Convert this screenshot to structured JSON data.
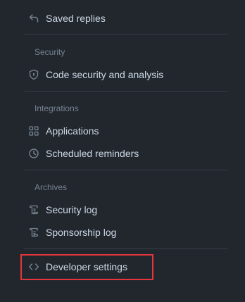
{
  "menu": {
    "partial_item_icon": "log-icon",
    "saved_replies": {
      "label": "Saved replies",
      "icon": "reply-icon"
    },
    "sections": [
      {
        "title": "Security",
        "items": [
          {
            "label": "Code security and analysis",
            "icon": "shield-lock-icon"
          }
        ]
      },
      {
        "title": "Integrations",
        "items": [
          {
            "label": "Applications",
            "icon": "apps-grid-icon"
          },
          {
            "label": "Scheduled reminders",
            "icon": "clock-icon"
          }
        ]
      },
      {
        "title": "Archives",
        "items": [
          {
            "label": "Security log",
            "icon": "log-icon"
          },
          {
            "label": "Sponsorship log",
            "icon": "log-icon"
          }
        ]
      }
    ],
    "developer_settings": {
      "label": "Developer settings",
      "icon": "code-icon"
    }
  },
  "colors": {
    "background": "#22272e",
    "text": "#cdd9e5",
    "muted": "#768390",
    "divider": "#373e47",
    "highlight": "#e5343b"
  }
}
